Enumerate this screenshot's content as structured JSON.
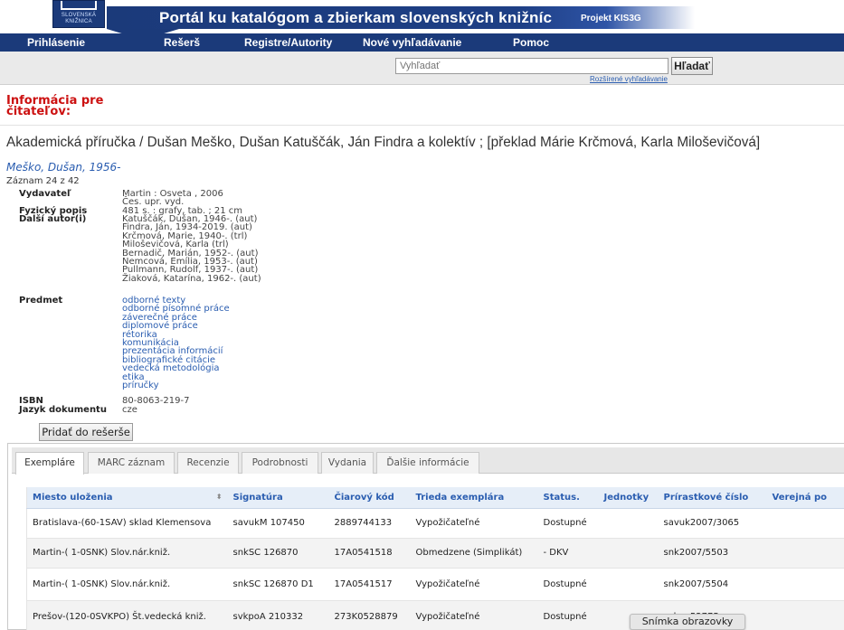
{
  "header": {
    "logo_text": "SLOVENSKÁ KNIŽNICA",
    "portal_title": "Portál ku katalógom a zbierkam slovenských knižníc",
    "project_label": "Projekt KIS3G"
  },
  "nav": {
    "items": [
      "Prihlásenie",
      "Rešerš",
      "Registre/Autority",
      "Nové vyhľadávanie",
      "Pomoc"
    ]
  },
  "search": {
    "placeholder": "Vyhľadať",
    "button_label": "Hľadať",
    "advanced_link": "Rozšírené vyhľadávanie"
  },
  "reader_info": "Informácia pre čitateľov:",
  "record": {
    "title": "Akademická příručka / Dušan Meško, Dušan Katuščák, Ján Findra a kolektív ; [překlad Márie Krčmová, Karla Miloševičová]",
    "author_link": "Meško, Dušan, 1956-",
    "record_count": "Záznam 24 z 42",
    "fields": {
      "publisher_label": "Vydavateľ",
      "publisher": [
        "Martin : Osveta , 2006",
        "Čes. upr. vyd."
      ],
      "physical_label": "Fyzický popis",
      "physical": "481 s. : grafy, tab. ; 21 cm",
      "other_authors_label": "Další autor(i)",
      "other_authors": [
        "Katuščák, Dušan, 1946-. (aut)",
        "Findra, Ján, 1934-2019. (aut)",
        "Krčmová, Marie, 1940-. (trl)",
        "Miloševičová, Karla (trl)",
        "Bernadič, Marián, 1952-. (aut)",
        "Nemcová, Emília, 1953-. (aut)",
        "Pullmann, Rudolf, 1937-. (aut)",
        "Žiaková, Katarína, 1962-. (aut)"
      ],
      "subject_label": "Predmet",
      "subjects": [
        "odborné texty",
        "odborné písomné práce",
        "záverečné práce",
        "diplomové práce",
        "rétorika",
        "komunikácia",
        "prezentácia informácií",
        "bibliografické citácie",
        "vedecká metodológia",
        "etika",
        "príručky"
      ],
      "isbn_label": "ISBN",
      "isbn": "80-8063-219-7",
      "language_label": "Jazyk dokumentu",
      "language": "cze"
    },
    "add_button": "Pridať do rešerše"
  },
  "tabs": [
    "Exempláre",
    "MARC záznam",
    "Recenzie",
    "Podrobnosti",
    "Vydania",
    "Ďalšie informácie"
  ],
  "holdings": {
    "headers": [
      "Miesto uloženia",
      "Signatúra",
      "Čiarový kód",
      "Trieda exemplára",
      "Status.",
      "Jednotky",
      "Prírastkové číslo",
      "Verejná po"
    ],
    "rows": [
      [
        "Bratislava-(60-1SAV) sklad Klemensova",
        "savukM 107450",
        "2889744133",
        "Vypožičateľné",
        "Dostupné",
        "",
        "savuk2007/3065",
        ""
      ],
      [
        "Martin-( 1-0SNK) Slov.nár.kniž.",
        "snkSC 126870",
        "17A0541518",
        "Obmedzene (Simplikát)",
        "- DKV",
        "",
        "snk2007/5503",
        ""
      ],
      [
        "Martin-( 1-0SNK) Slov.nár.kniž.",
        "snkSC 126870 D1",
        "17A0541517",
        "Vypožičateľné",
        "Dostupné",
        "",
        "snk2007/5504",
        ""
      ],
      [
        "Prešov-(120-0SVKPO) Št.vedecká kniž.",
        "svkpoA 210332",
        "273K0528879",
        "Vypožičateľné",
        "Dostupné",
        "",
        "svkpo52775",
        ""
      ]
    ]
  },
  "tooltip": "Snímka obrazovky"
}
